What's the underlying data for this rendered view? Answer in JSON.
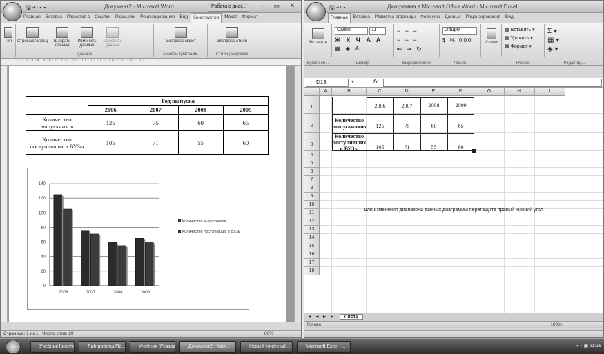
{
  "word": {
    "title": "Документ2 - Microsoft Word",
    "context_tab": "Работа с диаг...",
    "quick_access": "🖫 ↶ ▾ ▾",
    "tabs": [
      "Главная",
      "Вставка",
      "Разметка с",
      "Ссылки",
      "Рассылки",
      "Рецензирование",
      "Вид",
      "Конструктор",
      "Макет",
      "Формат"
    ],
    "active_tab": 7,
    "ribbon": {
      "type_btn": "Тип",
      "row_col_btn": "Строка/столбец",
      "select_data_btn": "Выбрать данные",
      "edit_data_btn": "Изменить данные",
      "refresh_data_btn": "Обновить данные",
      "group_data": "Данные",
      "layouts_btn": "Экспресс-макет",
      "group_layouts": "Макеты диаграмм",
      "styles_btn": "Экспресс-стили",
      "group_styles": "Стили диаграмм"
    },
    "table": {
      "group_header": "Год выпуска",
      "years": [
        "2006",
        "2007",
        "2008",
        "2009"
      ],
      "rows": [
        {
          "label": "Количество выпускников",
          "values": [
            "125",
            "75",
            "60",
            "65"
          ]
        },
        {
          "label": "Количество поступивших в ВУЗы",
          "values": [
            "105",
            "71",
            "55",
            "60"
          ]
        }
      ]
    },
    "status_page": "Страница: 1 из 1",
    "status_words": "Число слов: 20",
    "status_zoom": "80%"
  },
  "chart_data": {
    "type": "bar",
    "categories": [
      "2006",
      "2007",
      "2008",
      "2009"
    ],
    "series": [
      {
        "name": "Количество выпускников",
        "values": [
          125,
          75,
          60,
          65
        ]
      },
      {
        "name": "Количество поступивших в ВУЗы",
        "values": [
          105,
          71,
          55,
          60
        ]
      }
    ],
    "ylim": [
      0,
      140
    ],
    "yticks": [
      "0",
      "20",
      "40",
      "60",
      "80",
      "100",
      "120",
      "140"
    ],
    "grid": true,
    "legend_position": "right",
    "colors": {
      "series1": "#2b2b2b",
      "series2": "#3c3c3c"
    }
  },
  "excel": {
    "title": "Диаграмма в Microsoft Office Word - Microsoft Excel",
    "tabs": [
      "Главная",
      "Вставка",
      "Разметка страницы",
      "Формулы",
      "Данные",
      "Рецензирование",
      "Вид"
    ],
    "active_tab": 0,
    "ribbon": {
      "paste_btn": "Вставить",
      "group_clipboard": "Буфер об...",
      "font_name": "Calibri",
      "font_size": "11",
      "group_font": "Шрифт",
      "group_align": "Выравнивание",
      "number_format": "Общий",
      "group_number": "Число",
      "styles_btn": "Стили",
      "insert_btn": "Вставить",
      "delete_btn": "Удалить",
      "format_btn": "Формат",
      "group_cells": "Ячейки",
      "group_edit": "Редактир..."
    },
    "name_box": "D13",
    "fx_symbol": "fx",
    "columns": [
      "A",
      "B",
      "C",
      "D",
      "E",
      "F",
      "G",
      "H",
      "I"
    ],
    "rows": [
      "1",
      "2",
      "3",
      "4",
      "5",
      "6",
      "7",
      "8",
      "9",
      "10",
      "11",
      "12",
      "13",
      "14",
      "15",
      "16",
      "17",
      "18"
    ],
    "cells": {
      "b1": "2006",
      "c1": "2007",
      "d1": "2008",
      "e1": "2009",
      "a2": "Количество выпускников",
      "b2": "125",
      "c2": "75",
      "d2": "60",
      "e2": "65",
      "a3": "Количество поступивших в ВУЗы",
      "b3": "105",
      "c3": "71",
      "d3": "55",
      "e3": "60"
    },
    "hint": "Для изменения диапазона данных диаграммы перетащите правый нижний угол",
    "sheet_tab": "Лист1",
    "status_ready": "Готово",
    "status_zoom": "100%"
  },
  "taskbar": {
    "items": [
      "Учебник Киселев...",
      "Лаб работы Пр...",
      "Учебник (Режим...",
      "Документ2 - Micr...",
      "Новый точечный...",
      "Microsoft Excel -..."
    ],
    "active_index": 3,
    "clock": "11:38"
  }
}
